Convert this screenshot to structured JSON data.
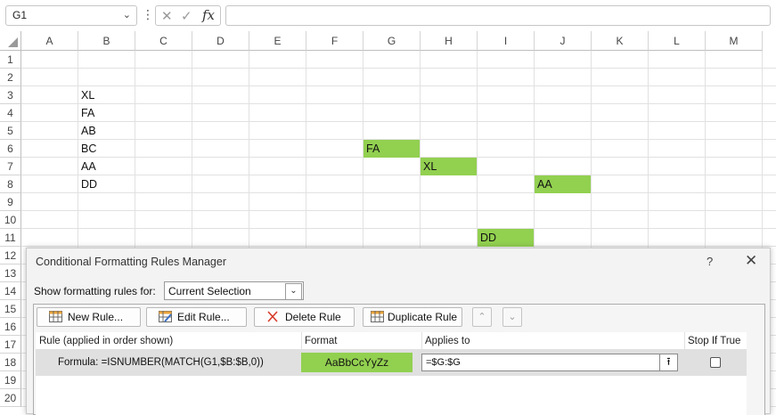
{
  "formula_bar": {
    "name_box": "G1",
    "more_glyph": "⋮",
    "cancel_glyph": "✕",
    "enter_glyph": "✓",
    "fx_glyph": "fx",
    "formula": ""
  },
  "grid": {
    "columns": [
      "A",
      "B",
      "C",
      "D",
      "E",
      "F",
      "G",
      "H",
      "I",
      "J",
      "K",
      "L",
      "M"
    ],
    "rows": [
      "1",
      "2",
      "3",
      "4",
      "5",
      "6",
      "7",
      "8",
      "9",
      "10",
      "11",
      "12",
      "13",
      "14",
      "15",
      "16",
      "17",
      "18",
      "19",
      "20"
    ],
    "cells": {
      "B3": "XL",
      "B4": "FA",
      "B5": "AB",
      "B6": "BC",
      "B7": "AA",
      "B8": "DD",
      "G6": "FA",
      "H7": "XL",
      "J8": "AA",
      "I11": "DD"
    },
    "highlight_color": "#92d050"
  },
  "dialog": {
    "title": "Conditional Formatting Rules Manager",
    "help": "?",
    "close": "✕",
    "show_label": "Show formatting rules for:",
    "show_value": "Current Selection",
    "buttons": {
      "new_rule": "New Rule...",
      "edit_rule": "Edit Rule...",
      "delete_rule": "Delete Rule",
      "duplicate_rule": "Duplicate Rule"
    },
    "move_up": "⌃",
    "move_down": "⌄",
    "table": {
      "headers": [
        "Rule (applied in order shown)",
        "Format",
        "Applies to",
        "Stop If True"
      ],
      "rule": {
        "formula": "Formula: =ISNUMBER(MATCH(G1,$B:$B,0))",
        "format_preview": "AaBbCcYyZz",
        "applies_to": "=$G:$G",
        "collapse_glyph": "⭱",
        "stop_if_true": false
      }
    }
  }
}
